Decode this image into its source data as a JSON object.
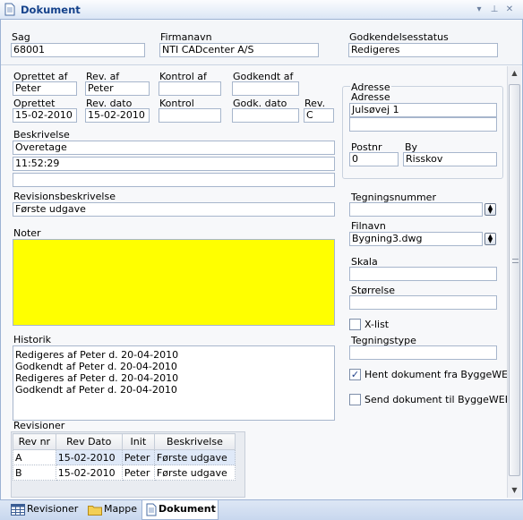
{
  "window": {
    "title": "Dokument"
  },
  "header": {
    "sag_label": "Sag",
    "sag_value": "68001",
    "firma_label": "Firmanavn",
    "firma_value": "NTI CADcenter A/S",
    "status_label": "Godkendelsesstatus",
    "status_value": "Redigeres"
  },
  "form": {
    "oprettet_af_label": "Oprettet af",
    "oprettet_af_value": "Peter",
    "rev_af_label": "Rev. af",
    "rev_af_value": "Peter",
    "kontrol_af_label": "Kontrol af",
    "kontrol_af_value": "",
    "godkendt_af_label": "Godkendt af",
    "godkendt_af_value": "",
    "oprettet_label": "Oprettet",
    "oprettet_value": "15-02-2010",
    "rev_dato_label": "Rev. dato",
    "rev_dato_value": "15-02-2010",
    "kontrol_label": "Kontrol",
    "kontrol_value": "",
    "godk_dato_label": "Godk. dato",
    "godk_dato_value": "",
    "rev_label": "Rev.",
    "rev_value": "C",
    "beskrivelse_label": "Beskrivelse",
    "beskrivelse_lines": [
      "Overetage",
      "11:52:29",
      ""
    ],
    "revisionsbeskrivelse_label": "Revisionsbeskrivelse",
    "revisionsbeskrivelse_value": "Første udgave",
    "noter_label": "Noter",
    "noter_color": "#ffff00",
    "historik_label": "Historik",
    "historik_lines": [
      "Redigeres af Peter d. 20-04-2010",
      "Godkendt af Peter d. 20-04-2010",
      "Redigeres af Peter d. 20-04-2010",
      "Godkendt af Peter d. 20-04-2010"
    ],
    "revisioner_label": "Revisioner"
  },
  "adresse": {
    "group_label": "Adresse",
    "adresse_label": "Adresse",
    "adresse_line1": "Julsøvej 1",
    "adresse_line2": "",
    "postnr_label": "Postnr",
    "postnr_value": "0",
    "by_label": "By",
    "by_value": "Risskov"
  },
  "right": {
    "tegningsnummer_label": "Tegningsnummer",
    "tegningsnummer_value": "",
    "filnavn_label": "Filnavn",
    "filnavn_value": "Bygning3.dwg",
    "skala_label": "Skala",
    "skala_value": "",
    "storrelse_label": "Størrelse",
    "storrelse_value": "",
    "xlist_label": "X-list",
    "xlist_checked": false,
    "tegningstype_label": "Tegningstype",
    "tegningstype_value": "",
    "hent_label": "Hent dokument fra ByggeWEB",
    "hent_checked": true,
    "send_label": "Send dokument til ByggeWEB",
    "send_checked": false
  },
  "revisions_table": {
    "columns": [
      "Rev nr",
      "Rev Dato",
      "Init",
      "Beskrivelse"
    ],
    "rows": [
      [
        "A",
        "15-02-2010",
        "Peter",
        "Første udgave"
      ],
      [
        "B",
        "15-02-2010",
        "Peter",
        "Første udgave"
      ]
    ]
  },
  "tabs": [
    {
      "label": "Revisioner",
      "icon": "table-icon"
    },
    {
      "label": "Mappe",
      "icon": "folder-icon"
    },
    {
      "label": "Dokument",
      "icon": "document-icon"
    }
  ],
  "colors": {
    "accent": "#15428b",
    "notes": "#ffff00",
    "border": "#9db3d4"
  }
}
